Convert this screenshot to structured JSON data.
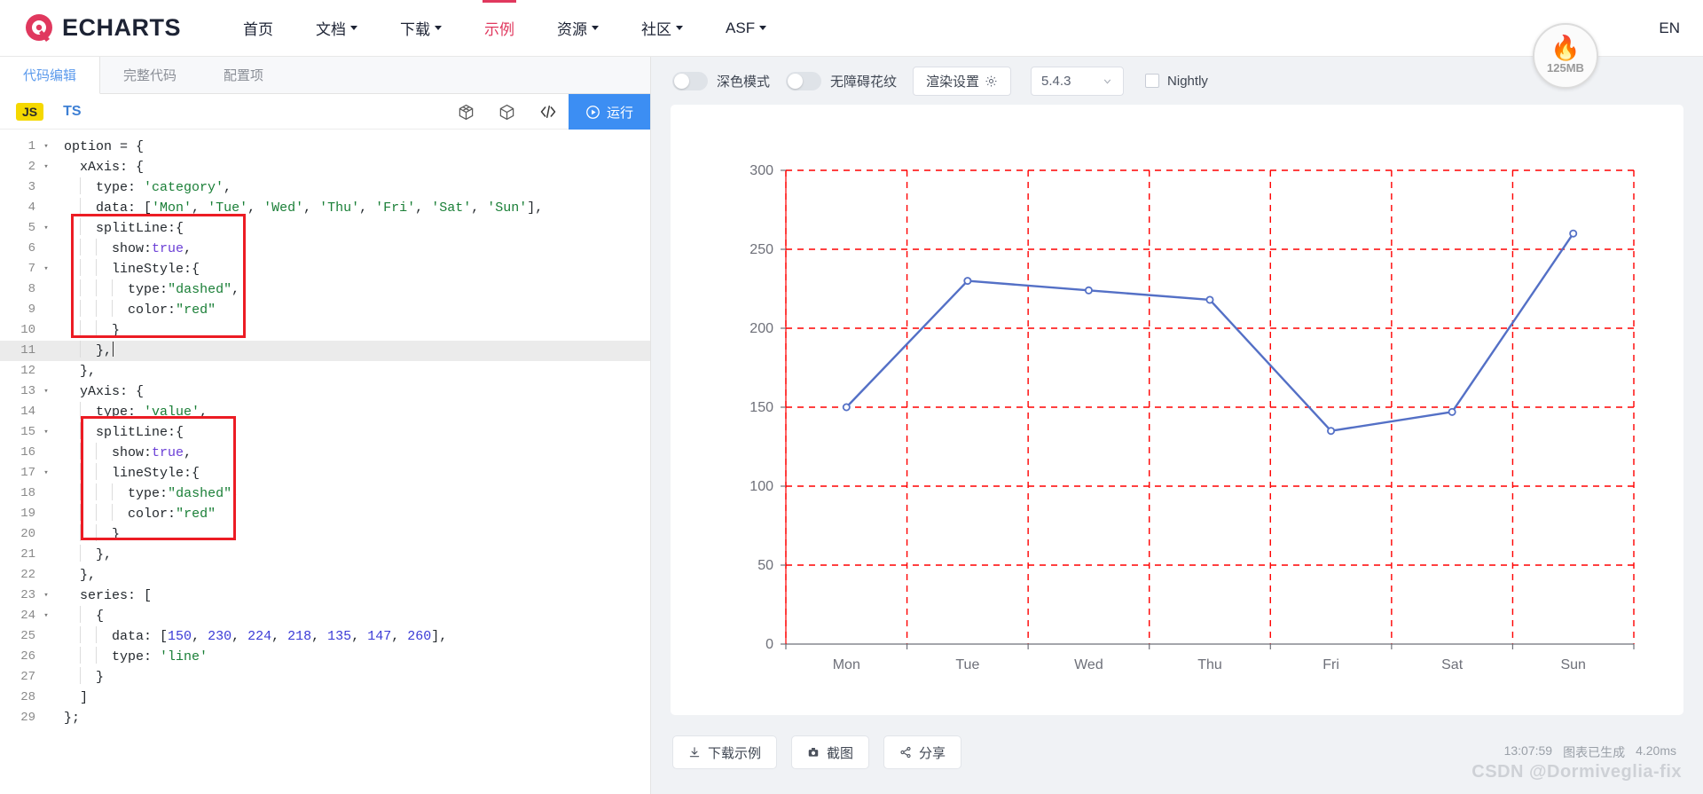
{
  "header": {
    "logo_text": "ECHARTS",
    "nav": [
      {
        "label": "首页",
        "has_caret": false,
        "active": false
      },
      {
        "label": "文档",
        "has_caret": true,
        "active": false
      },
      {
        "label": "下载",
        "has_caret": true,
        "active": false
      },
      {
        "label": "示例",
        "has_caret": false,
        "active": true
      },
      {
        "label": "资源",
        "has_caret": true,
        "active": false
      },
      {
        "label": "社区",
        "has_caret": true,
        "active": false
      },
      {
        "label": "ASF",
        "has_caret": true,
        "active": false
      }
    ],
    "lang_switch": "EN",
    "memory_badge": {
      "icon": "flame-icon",
      "value": "125MB"
    }
  },
  "editor_panel": {
    "tabs": [
      {
        "label": "代码编辑",
        "active": true
      },
      {
        "label": "完整代码",
        "active": false
      },
      {
        "label": "配置项",
        "active": false
      }
    ],
    "lang_js": "JS",
    "lang_ts": "TS",
    "icons": [
      "sandbox-icon",
      "cube-icon",
      "code-brackets-icon"
    ],
    "run_label": "运行"
  },
  "code": {
    "lines": [
      {
        "n": "1",
        "fold": "▾",
        "indent": 0,
        "text": "option = {"
      },
      {
        "n": "2",
        "fold": "▾",
        "indent": 0,
        "text": "  xAxis: {"
      },
      {
        "n": "3",
        "fold": "",
        "indent": 1,
        "text": "    type: 'category',"
      },
      {
        "n": "4",
        "fold": "",
        "indent": 1,
        "text": "    data: ['Mon', 'Tue', 'Wed', 'Thu', 'Fri', 'Sat', 'Sun'],"
      },
      {
        "n": "5",
        "fold": "▾",
        "indent": 1,
        "text": "    splitLine:{"
      },
      {
        "n": "6",
        "fold": "",
        "indent": 2,
        "text": "      show:true,"
      },
      {
        "n": "7",
        "fold": "▾",
        "indent": 2,
        "text": "      lineStyle:{"
      },
      {
        "n": "8",
        "fold": "",
        "indent": 3,
        "text": "        type:\"dashed\","
      },
      {
        "n": "9",
        "fold": "",
        "indent": 3,
        "text": "        color:\"red\""
      },
      {
        "n": "10",
        "fold": "",
        "indent": 2,
        "text": "      }"
      },
      {
        "n": "11",
        "fold": "",
        "indent": 1,
        "text": "    },",
        "highlight": true,
        "cursor": true
      },
      {
        "n": "12",
        "fold": "",
        "indent": 0,
        "text": "  },"
      },
      {
        "n": "13",
        "fold": "▾",
        "indent": 0,
        "text": "  yAxis: {"
      },
      {
        "n": "14",
        "fold": "",
        "indent": 1,
        "text": "    type: 'value',"
      },
      {
        "n": "15",
        "fold": "▾",
        "indent": 1,
        "text": "    splitLine:{"
      },
      {
        "n": "16",
        "fold": "",
        "indent": 2,
        "text": "      show:true,"
      },
      {
        "n": "17",
        "fold": "▾",
        "indent": 2,
        "text": "      lineStyle:{"
      },
      {
        "n": "18",
        "fold": "",
        "indent": 3,
        "text": "        type:\"dashed\","
      },
      {
        "n": "19",
        "fold": "",
        "indent": 3,
        "text": "        color:\"red\""
      },
      {
        "n": "20",
        "fold": "",
        "indent": 2,
        "text": "      }"
      },
      {
        "n": "21",
        "fold": "",
        "indent": 1,
        "text": "    },"
      },
      {
        "n": "22",
        "fold": "",
        "indent": 0,
        "text": "  },"
      },
      {
        "n": "23",
        "fold": "▾",
        "indent": 0,
        "text": "  series: ["
      },
      {
        "n": "24",
        "fold": "▾",
        "indent": 1,
        "text": "    {"
      },
      {
        "n": "25",
        "fold": "",
        "indent": 2,
        "text": "      data: [150, 230, 224, 218, 135, 147, 260],"
      },
      {
        "n": "26",
        "fold": "",
        "indent": 2,
        "text": "      type: 'line'"
      },
      {
        "n": "27",
        "fold": "",
        "indent": 1,
        "text": "    }"
      },
      {
        "n": "28",
        "fold": "",
        "indent": 0,
        "text": "  ]"
      },
      {
        "n": "29",
        "fold": "",
        "indent": 0,
        "text": "};"
      }
    ],
    "annotation_boxes": 2
  },
  "preview_toolbar": {
    "dark_mode_label": "深色模式",
    "dark_mode_on": false,
    "accessibility_label": "无障碍花纹",
    "accessibility_on": false,
    "render_settings_label": "渲染设置",
    "render_settings_icon": "gear-icon",
    "version": "5.4.3",
    "nightly_label": "Nightly",
    "nightly_checked": false
  },
  "chart_data": {
    "type": "line",
    "title": "",
    "categories": [
      "Mon",
      "Tue",
      "Wed",
      "Thu",
      "Fri",
      "Sat",
      "Sun"
    ],
    "values": [
      150,
      230,
      224,
      218,
      135,
      147,
      260
    ],
    "series": [
      {
        "name": "",
        "values": [
          150,
          230,
          224,
          218,
          135,
          147,
          260
        ]
      }
    ],
    "xlabel": "",
    "ylabel": "",
    "ylim": [
      0,
      300
    ],
    "yticks": [
      0,
      50,
      100,
      150,
      200,
      250,
      300
    ],
    "grid": true,
    "grid_color": "#ff0000",
    "grid_style": "dashed",
    "line_color": "#5470c6",
    "legend": false
  },
  "bottom_bar": {
    "buttons": [
      {
        "label": "下载示例",
        "icon": "download-icon"
      },
      {
        "label": "截图",
        "icon": "camera-icon"
      },
      {
        "label": "分享",
        "icon": "share-icon"
      }
    ],
    "time": "13:07:59",
    "status": "图表已生成",
    "duration": "4.20ms",
    "watermark": "CSDN @Dormiveglia-fix"
  }
}
